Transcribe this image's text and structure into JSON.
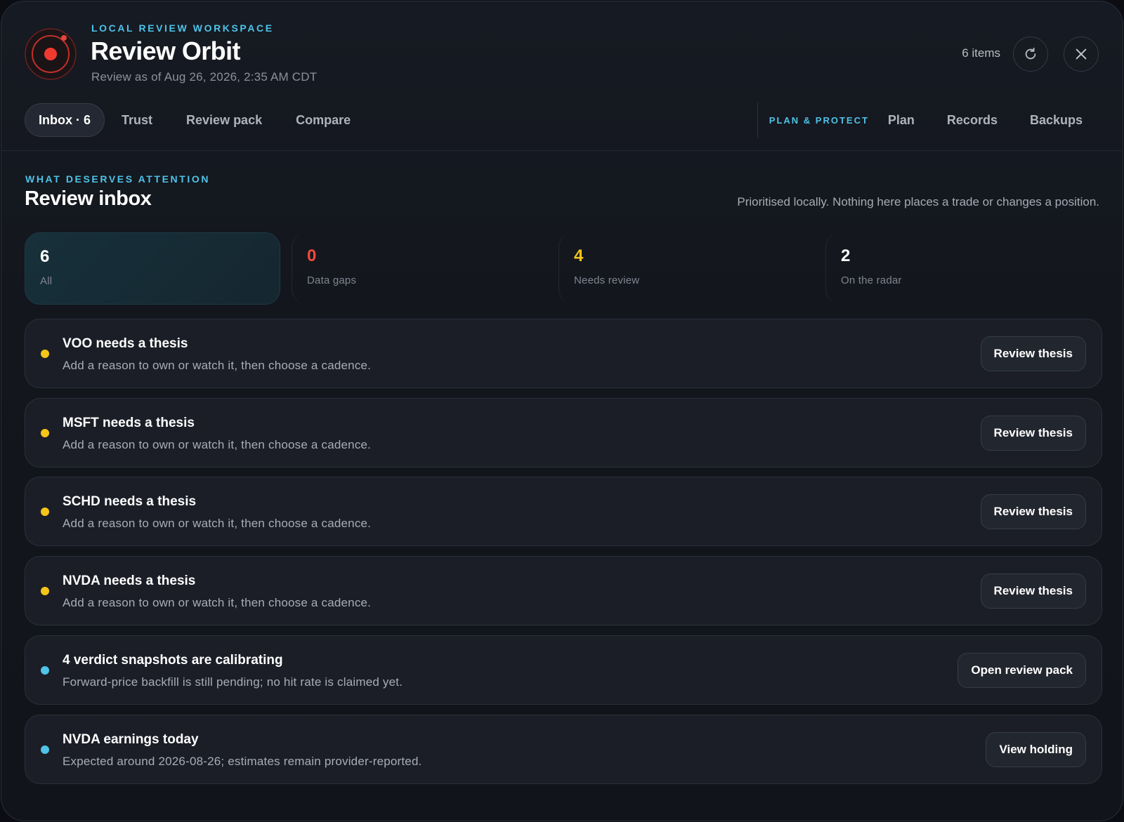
{
  "header": {
    "eyebrow": "LOCAL REVIEW WORKSPACE",
    "title": "Review Orbit",
    "subtitle": "Review as of Aug 26, 2026, 2:35 AM CDT",
    "item_count": "6 items",
    "refresh_icon": "refresh-icon",
    "close_icon": "close-icon"
  },
  "tabs": {
    "left": [
      {
        "label": "Inbox · 6",
        "active": true
      },
      {
        "label": "Trust"
      },
      {
        "label": "Review pack"
      },
      {
        "label": "Compare"
      }
    ],
    "group_label": "PLAN & PROTECT",
    "right": [
      {
        "label": "Plan"
      },
      {
        "label": "Records"
      },
      {
        "label": "Backups"
      }
    ]
  },
  "section": {
    "eyebrow": "WHAT DESERVES ATTENTION",
    "title": "Review inbox",
    "note": "Prioritised locally. Nothing here places a trade or changes a position."
  },
  "stats": [
    {
      "value": "6",
      "label": "All",
      "color": "#ffffff",
      "selected": true
    },
    {
      "value": "0",
      "label": "Data gaps",
      "color": "#f04a3c"
    },
    {
      "value": "4",
      "label": "Needs review",
      "color": "#f5c518"
    },
    {
      "value": "2",
      "label": "On the radar",
      "color": "#ffffff"
    }
  ],
  "items": [
    {
      "title": "VOO needs a thesis",
      "desc": "Add a reason to own or watch it, then choose a cadence.",
      "action": "Review thesis",
      "dot": "#f5c518"
    },
    {
      "title": "MSFT needs a thesis",
      "desc": "Add a reason to own or watch it, then choose a cadence.",
      "action": "Review thesis",
      "dot": "#f5c518"
    },
    {
      "title": "SCHD needs a thesis",
      "desc": "Add a reason to own or watch it, then choose a cadence.",
      "action": "Review thesis",
      "dot": "#f5c518"
    },
    {
      "title": "NVDA needs a thesis",
      "desc": "Add a reason to own or watch it, then choose a cadence.",
      "action": "Review thesis",
      "dot": "#f5c518"
    },
    {
      "title": "4 verdict snapshots are calibrating",
      "desc": "Forward-price backfill is still pending; no hit rate is claimed yet.",
      "action": "Open review pack",
      "dot": "#4fc3e8"
    },
    {
      "title": "NVDA earnings today",
      "desc": "Expected around 2026-08-26; estimates remain provider-reported.",
      "action": "View holding",
      "dot": "#4fc3e8"
    }
  ],
  "colors": {
    "accent": "#4fc3e8",
    "warning": "#f5c518",
    "danger": "#f04a3c"
  }
}
